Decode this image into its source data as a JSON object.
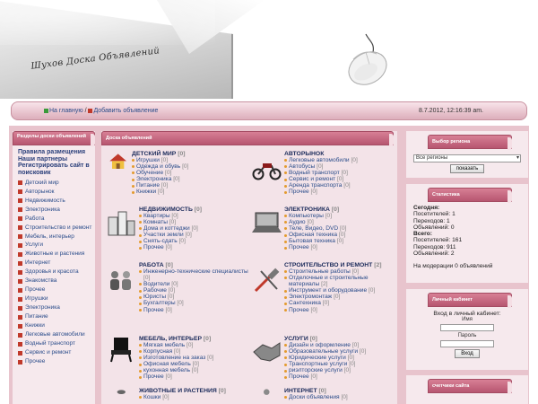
{
  "header": {
    "logo_text": "Шухов Доска Объявлений"
  },
  "nav": {
    "home": "На главную",
    "separator": "/",
    "add": "Добавить объявление",
    "datetime": "8.7.2012, 12:16:39 am."
  },
  "left": {
    "title": "Разделы доски объявлений",
    "bold_links": [
      "Правила размещения",
      "Наши партнеры",
      "Регистрировать сайт в поисковик"
    ],
    "items": [
      "Детский мир",
      "Авторынок",
      "Недвижимость",
      "Электроника",
      "Работа",
      "Строительство и ремонт",
      "Мебель, интерьер",
      "Услуги",
      "Животные и растения",
      "Интернет",
      "Здоровья и красота",
      "Знакомства",
      "Прочее",
      "Игрушки",
      "Электроника",
      "Питание",
      "Книжки",
      "Легковые автомобили",
      "Водный транспорт",
      "Сервис и ремонт",
      "Прочее"
    ]
  },
  "center": {
    "title": "Доска объявлений",
    "categories": [
      {
        "title": "ДЕТСКИЙ МИР",
        "count": "[0]",
        "items": [
          [
            "Игрушки",
            "[0]"
          ],
          [
            "Одежда и обувь",
            "[0]"
          ],
          [
            "Обучение",
            "[0]"
          ],
          [
            "Электроника",
            "[0]"
          ],
          [
            "Питание",
            "[0]"
          ],
          [
            "Книжки",
            "[0]"
          ]
        ]
      },
      {
        "title": "АВТОРЫНОК",
        "count": "",
        "items": [
          [
            "Легковые автомобили",
            "[0]"
          ],
          [
            "Автобусы",
            "[0]"
          ],
          [
            "Водный транспорт",
            "[0]"
          ],
          [
            "Сервис и ремонт",
            "[0]"
          ],
          [
            "Аренда транспорта",
            "[0]"
          ],
          [
            "Прочее",
            "[0]"
          ]
        ]
      },
      {
        "title": "НЕДВИЖИМОСТЬ",
        "count": "[0]",
        "items": [
          [
            "Квартиры",
            "[0]"
          ],
          [
            "Комнаты",
            "[0]"
          ],
          [
            "Дома и коттеджи",
            "[0]"
          ],
          [
            "Участки земли",
            "[0]"
          ],
          [
            "Снять-сдать",
            "[0]"
          ],
          [
            "Прочее",
            "[0]"
          ]
        ]
      },
      {
        "title": "ЭЛЕКТРОНИКА",
        "count": "[0]",
        "items": [
          [
            "Компьютеры",
            "[0]"
          ],
          [
            "Аудио",
            "[0]"
          ],
          [
            "Теле, Видео, DVD",
            "[0]"
          ],
          [
            "Офисная техника",
            "[0]"
          ],
          [
            "Бытовая техника",
            "[0]"
          ],
          [
            "Прочее",
            "[0]"
          ]
        ]
      },
      {
        "title": "РАБОТА",
        "count": "[0]",
        "items": [
          [
            "Инженерно-технические специалисты",
            "[0]"
          ],
          [
            "Водители",
            "[0]"
          ],
          [
            "Рабочие",
            "[0]"
          ],
          [
            "Юристы",
            "[0]"
          ],
          [
            "Бухгалтеры",
            "[0]"
          ],
          [
            "Прочее",
            "[0]"
          ]
        ]
      },
      {
        "title": "СТРОИТЕЛЬСТВО И РЕМОНТ",
        "count": "[2]",
        "items": [
          [
            "Строительные работы",
            "[0]"
          ],
          [
            "Отделочные и строительные материалы",
            "[2]"
          ],
          [
            "Инструмент и оборудование",
            "[0]"
          ],
          [
            "Электромонтаж",
            "[0]"
          ],
          [
            "Сантехника",
            "[0]"
          ],
          [
            "Прочее",
            "[0]"
          ]
        ]
      },
      {
        "title": "МЕБЕЛЬ, ИНТЕРЬЕР",
        "count": "[0]",
        "items": [
          [
            "Мягкая мебель",
            "[0]"
          ],
          [
            "Корпусная",
            "[0]"
          ],
          [
            "Изготовление на заказ",
            "[0]"
          ],
          [
            "Офисная мебель",
            "[0]"
          ],
          [
            "кухонная мебель",
            "[0]"
          ],
          [
            "Прочее",
            "[0]"
          ]
        ]
      },
      {
        "title": "УСЛУГИ",
        "count": "[0]",
        "items": [
          [
            "Дизайн и оформление",
            "[0]"
          ],
          [
            "Образовательные услуги",
            "[0]"
          ],
          [
            "Юридические услуги",
            "[0]"
          ],
          [
            "Транспортные услуги",
            "[0]"
          ],
          [
            "риэлторские услуги",
            "[0]"
          ],
          [
            "Прочее",
            "[0]"
          ]
        ]
      },
      {
        "title": "ЖИВОТНЫЕ И РАСТЕНИЯ",
        "count": "[0]",
        "items": [
          [
            "Кошки",
            "[0]"
          ]
        ]
      },
      {
        "title": "ИНТЕРНЕТ",
        "count": "[0]",
        "items": [
          [
            "Доски объявления",
            "[0]"
          ]
        ]
      }
    ]
  },
  "region": {
    "title": "Выбор региона",
    "selected": "Все регионы",
    "button": "показать"
  },
  "stats": {
    "title": "Статистика",
    "lines": [
      "Сегодня:",
      "Посетителей: 1",
      "Переходов: 1",
      "Объявлений: 0",
      "Всего:",
      "Посетителей: 161",
      "Переходов: 911",
      "Объявлений: 2",
      "",
      "На модерации 0 объявлений"
    ]
  },
  "login": {
    "title": "Личный кабинет",
    "prompt": "Вход в личный кабинет:",
    "name_label": "Имя",
    "pass_label": "Пароль",
    "button": "Вход"
  },
  "counter": {
    "title": "счетчики сайта"
  },
  "colors": {
    "accent": "#b75670",
    "panel": "#f6e9ed",
    "link": "#2a4c8a"
  }
}
